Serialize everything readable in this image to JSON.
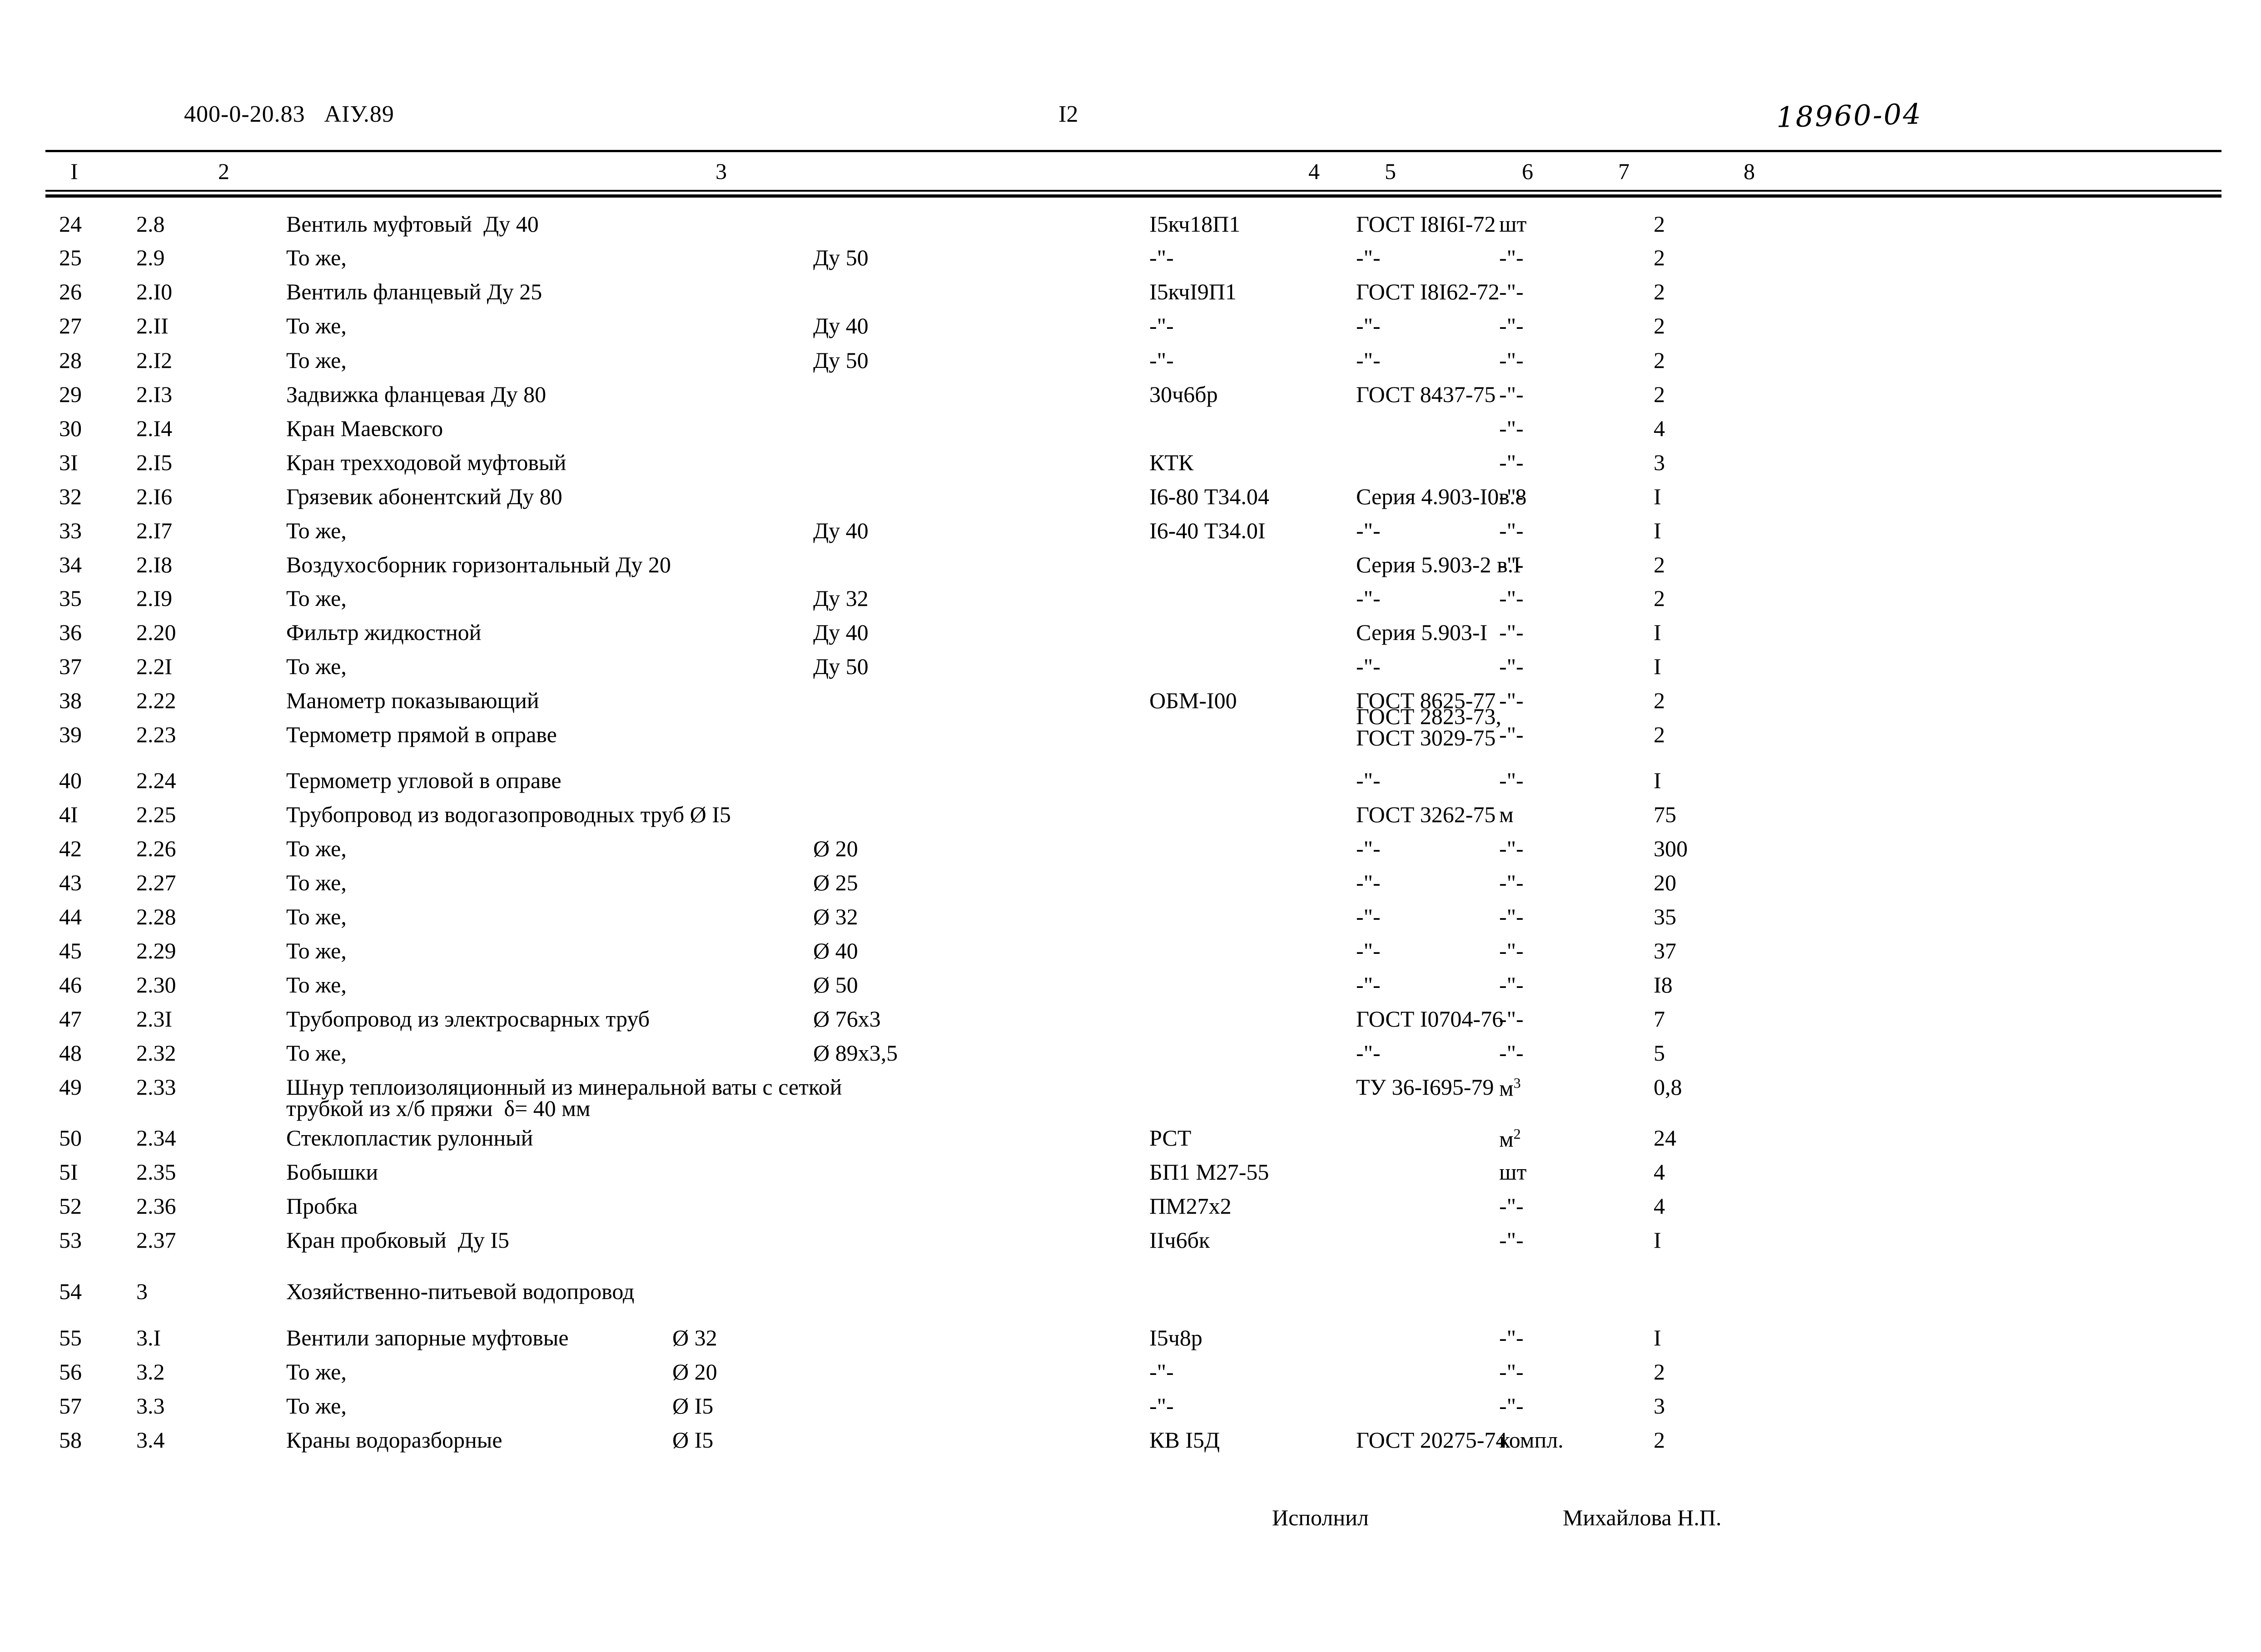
{
  "header": {
    "doc_code": "400-0-20.83   АIУ.89",
    "page_number": "I2",
    "handwritten_code": "18960-04"
  },
  "table": {
    "column_headers": [
      "I",
      "2",
      "3",
      "4",
      "5",
      "6",
      "7",
      "8"
    ],
    "ditto_mark": "-\"-",
    "rows": [
      {
        "n": "24",
        "pos": "2.8",
        "name": "Вентиль муфтовый  Ду 40",
        "size": "",
        "mark": "I5кч18П1",
        "standard": "ГОСТ I8I6I-72",
        "unit": "шт",
        "qty": "2"
      },
      {
        "n": "25",
        "pos": "2.9",
        "name": "То же,",
        "size": "Ду 50",
        "mark": "-\"-",
        "standard": "-\"-",
        "unit": "-\"-",
        "qty": "2"
      },
      {
        "n": "26",
        "pos": "2.I0",
        "name": "Вентиль фланцевый Ду 25",
        "size": "",
        "mark": "I5кчI9П1",
        "standard": "ГОСТ I8I62-72",
        "unit": "-\"-",
        "qty": "2"
      },
      {
        "n": "27",
        "pos": "2.II",
        "name": "То же,",
        "size": "Ду 40",
        "mark": "-\"-",
        "standard": "-\"-",
        "unit": "-\"-",
        "qty": "2"
      },
      {
        "n": "28",
        "pos": "2.I2",
        "name": "То же,",
        "size": "Ду 50",
        "mark": "-\"-",
        "standard": "-\"-",
        "unit": "-\"-",
        "qty": "2"
      },
      {
        "n": "29",
        "pos": "2.I3",
        "name": "Задвижка фланцевая Ду 80",
        "size": "",
        "mark": "30ч6бр",
        "standard": "ГОСТ 8437-75",
        "unit": "-\"-",
        "qty": "2"
      },
      {
        "n": "30",
        "pos": "2.I4",
        "name": "Кран Маевского",
        "size": "",
        "mark": "",
        "standard": "",
        "unit": "-\"-",
        "qty": "4"
      },
      {
        "n": "3I",
        "pos": "2.I5",
        "name": "Кран трехходовой муфтовый",
        "size": "",
        "mark": "КТК",
        "standard": "",
        "unit": "-\"-",
        "qty": "3"
      },
      {
        "n": "32",
        "pos": "2.I6",
        "name": "Грязевик абонентский Ду 80",
        "size": "",
        "mark": "I6-80 Т34.04",
        "standard": "Серия 4.903-I0в.8",
        "unit": "-\"-",
        "qty": "I"
      },
      {
        "n": "33",
        "pos": "2.I7",
        "name": "То же,",
        "size": "Ду 40",
        "mark": "I6-40 Т34.0I",
        "standard": "-\"-",
        "unit": "-\"-",
        "qty": "I"
      },
      {
        "n": "34",
        "pos": "2.I8",
        "name": "Воздухосборник горизонтальный Ду 20",
        "size": "",
        "mark": "",
        "standard": "Серия 5.903-2 в.I",
        "unit": "-\"-",
        "qty": "2"
      },
      {
        "n": "35",
        "pos": "2.I9",
        "name": "То же,",
        "size": "Ду 32",
        "mark": "",
        "standard": "-\"-",
        "unit": "-\"-",
        "qty": "2"
      },
      {
        "n": "36",
        "pos": "2.20",
        "name": "Фильтр жидкостной",
        "size": "Ду 40",
        "mark": "",
        "standard": "Серия 5.903-I",
        "unit": "-\"-",
        "qty": "I"
      },
      {
        "n": "37",
        "pos": "2.2I",
        "name": "То же,",
        "size": "Ду 50",
        "mark": "",
        "standard": "-\"-",
        "unit": "-\"-",
        "qty": "I"
      },
      {
        "n": "38",
        "pos": "2.22",
        "name": "Манометр показывающий",
        "size": "",
        "mark": "ОБМ-I00",
        "standard": "ГОСТ 8625-77",
        "unit": "-\"-",
        "qty": "2"
      },
      {
        "n": "39",
        "pos": "2.23",
        "name": "Термометр прямой в оправе",
        "size": "",
        "mark": "",
        "standard": "ГОСТ 2823-73,|ГОСТ 3029-75",
        "unit": "-\"-",
        "qty": "2"
      },
      {
        "n": "40",
        "pos": "2.24",
        "name": "Термометр угловой в оправе",
        "size": "",
        "mark": "",
        "standard": "-\"-",
        "unit": "-\"-",
        "qty": "I"
      },
      {
        "n": "4I",
        "pos": "2.25",
        "name": "Трубопровод из водогазопроводных труб Ø I5",
        "size": "",
        "mark": "",
        "standard": "ГОСТ 3262-75",
        "unit": "м",
        "qty": "75"
      },
      {
        "n": "42",
        "pos": "2.26",
        "name": "То же,",
        "size": "Ø 20",
        "mark": "",
        "standard": "-\"-",
        "unit": "-\"-",
        "qty": "300"
      },
      {
        "n": "43",
        "pos": "2.27",
        "name": "То же,",
        "size": "Ø 25",
        "mark": "",
        "standard": "-\"-",
        "unit": "-\"-",
        "qty": "20"
      },
      {
        "n": "44",
        "pos": "2.28",
        "name": "То же,",
        "size": "Ø 32",
        "mark": "",
        "standard": "-\"-",
        "unit": "-\"-",
        "qty": "35"
      },
      {
        "n": "45",
        "pos": "2.29",
        "name": "То же,",
        "size": "Ø 40",
        "mark": "",
        "standard": "-\"-",
        "unit": "-\"-",
        "qty": "37"
      },
      {
        "n": "46",
        "pos": "2.30",
        "name": "То же,",
        "size": "Ø 50",
        "mark": "",
        "standard": "-\"-",
        "unit": "-\"-",
        "qty": "I8"
      },
      {
        "n": "47",
        "pos": "2.3I",
        "name": "Трубопровод из электросварных труб",
        "size": "Ø 76х3",
        "mark": "",
        "standard": "ГОСТ I0704-76",
        "unit": "-\"-",
        "qty": "7"
      },
      {
        "n": "48",
        "pos": "2.32",
        "name": "То же,",
        "size": "Ø 89х3,5",
        "mark": "",
        "standard": "-\"-",
        "unit": "-\"-",
        "qty": "5"
      },
      {
        "n": "49",
        "pos": "2.33",
        "name": "Шнур теплоизоляционный из минеральной ваты с сеткой|трубкой из х/б пряжи  δ= 40 мм",
        "size": "",
        "mark": "",
        "standard": "ТУ 36-I695-79",
        "unit": "м",
        "unit_sup": "3",
        "qty": "0,8"
      },
      {
        "n": "50",
        "pos": "2.34",
        "name": "Стеклопластик рулонный",
        "size": "",
        "mark": "РСТ",
        "standard": "",
        "unit": "м",
        "unit_sup": "2",
        "qty": "24"
      },
      {
        "n": "5I",
        "pos": "2.35",
        "name": "Бобышки",
        "size": "",
        "mark": "БП1 М27-55",
        "standard": "",
        "unit": "шт",
        "qty": "4"
      },
      {
        "n": "52",
        "pos": "2.36",
        "name": "Пробка",
        "size": "",
        "mark": "ПМ27х2",
        "standard": "",
        "unit": "-\"-",
        "qty": "4"
      },
      {
        "n": "53",
        "pos": "2.37",
        "name": "Кран пробковый  Ду I5",
        "size": "",
        "mark": "IIч6бк",
        "standard": "",
        "unit": "-\"-",
        "qty": "I"
      },
      {
        "n": "54",
        "pos": "3",
        "name": "Хозяйственно-питьевой водопровод",
        "size": "",
        "mark": "",
        "standard": "",
        "unit": "",
        "qty": ""
      },
      {
        "n": "55",
        "pos": "3.I",
        "name": "Вентили запорные муфтовые",
        "size": "Ø 32",
        "mark": "I5ч8р",
        "standard": "",
        "unit": "-\"-",
        "qty": "I"
      },
      {
        "n": "56",
        "pos": "3.2",
        "name": "То же,",
        "size": "Ø 20",
        "mark": "-\"-",
        "standard": "",
        "unit": "-\"-",
        "qty": "2"
      },
      {
        "n": "57",
        "pos": "3.3",
        "name": "То же,",
        "size": "Ø I5",
        "mark": "-\"-",
        "standard": "",
        "unit": "-\"-",
        "qty": "3"
      },
      {
        "n": "58",
        "pos": "3.4",
        "name": "Краны водоразборные",
        "size": "Ø I5",
        "mark": "КВ I5Д",
        "standard": "ГОСТ 20275-74",
        "unit": "компл.",
        "qty": "2"
      }
    ]
  },
  "footer": {
    "executed_by_label": "Исполнил",
    "executed_by_name": "Михайлова Н.П."
  }
}
